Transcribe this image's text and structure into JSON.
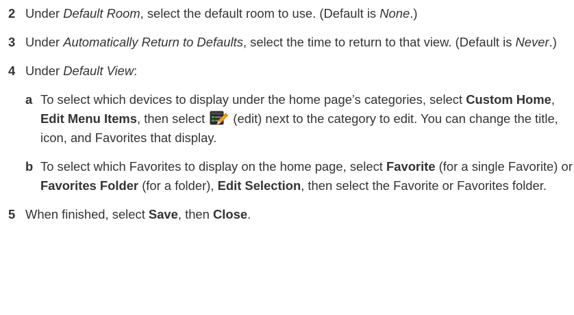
{
  "steps": [
    {
      "num": "2",
      "t1": "Under ",
      "i1": "Default Room",
      "t2": ", select the default room to use. (Default is ",
      "i2": "None",
      "t3": ".)"
    },
    {
      "num": "3",
      "t1": "Under ",
      "i1": "Automatically Return to Defaults",
      "t2": ", select the time to return to that view. (Default is ",
      "i2": "Never",
      "t3": ".)"
    },
    {
      "num": "4",
      "t1": "Under ",
      "i1": "Default View",
      "t2": ":"
    },
    {
      "num": "5",
      "t1": "When finished, select ",
      "b1": "Save",
      "t2": ", then ",
      "b2": "Close",
      "t3": "."
    }
  ],
  "substeps": [
    {
      "letter": "a",
      "t1": "To select which devices to display under the home page’s categories, select ",
      "b1": "Custom Home",
      "t2": ", ",
      "b2": "Edit Menu Items",
      "t3": ", then select ",
      "t4": " (edit) next to the category to edit. You can change the title, icon, and Favorites that display.",
      "icon": "edit-icon"
    },
    {
      "letter": "b",
      "t1": "To select which Favorites to display on the home page, select ",
      "b1": "Favorite",
      "t2": " (for a single Favorite) or ",
      "b2": "Favorites Folder",
      "t3": " (for a folder), ",
      "b3": "Edit Selection",
      "t4": ", then select the Favorite or Favorites folder."
    }
  ],
  "colors": {
    "text": "#333333",
    "icon_bg": "#2a2a2a",
    "icon_pencil": "#f2a51b",
    "icon_check": "#3da23d"
  }
}
